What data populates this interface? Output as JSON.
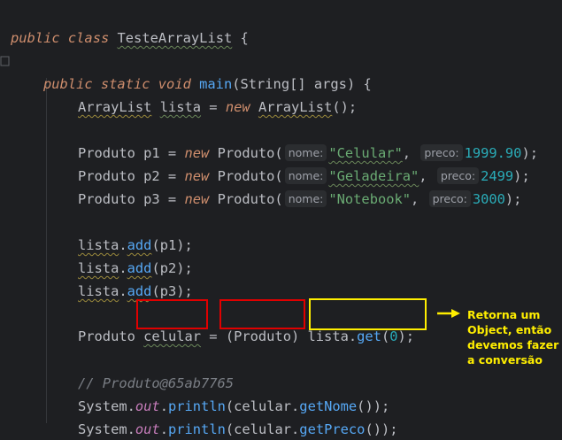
{
  "editor": {
    "lines": {
      "l1": {
        "kw1": "public",
        "kw2": "class",
        "name": "TesteArrayList",
        "brace": "{"
      },
      "l2": {
        "kw1": "public",
        "kw2": "static",
        "kw3": "void",
        "method": "main",
        "rest": "(String[] args) {"
      },
      "l3": {
        "type": "ArrayList",
        "var": "lista",
        "eq": " = ",
        "kw": "new",
        "ctor": "ArrayList",
        "rest": "();"
      },
      "l5": {
        "decl": "Produto p1 = ",
        "kw": "new",
        "ctor": "Produto(",
        "hint1": "nome:",
        "str": "\"Celular\"",
        "comma": ",",
        "hint2": "preco:",
        "num": "1999.90",
        "end": ");"
      },
      "l6": {
        "decl": "Produto p2 = ",
        "kw": "new",
        "ctor": "Produto(",
        "hint1": "nome:",
        "str": "\"Geladeira\"",
        "comma": ",",
        "hint2": "preco:",
        "num": "2499",
        "end": ");"
      },
      "l7": {
        "decl": "Produto p3 = ",
        "kw": "new",
        "ctor": "Produto(",
        "hint1": "nome:",
        "str": "\"Notebook\"",
        "comma": ",",
        "hint2": "preco:",
        "num": "3000",
        "end": ");"
      },
      "l9": {
        "obj": "lista",
        "dot": ".",
        "method": "add",
        "rest": "(p1);"
      },
      "l10": {
        "obj": "lista",
        "dot": ".",
        "method": "add",
        "rest": "(p2);"
      },
      "l11": {
        "obj": "lista",
        "dot": ".",
        "method": "add",
        "rest": "(p3);"
      },
      "l13": {
        "type": "Produto ",
        "var": "celular",
        "eq": " = ",
        "cast": "(Produto)",
        "obj": "lista",
        "dot": ".",
        "method": "get",
        "open": "(",
        "num": "0",
        "end": ");"
      },
      "l15": {
        "comment": "// Produto@65ab7765"
      },
      "l16": {
        "cls": "System",
        "dot1": ".",
        "field": "out",
        "dot2": ".",
        "method": "println",
        "open": "(",
        "obj": "celular",
        "dot3": ".",
        "method2": "getNome",
        "end": "());"
      },
      "l17": {
        "cls": "System",
        "dot1": ".",
        "field": "out",
        "dot2": ".",
        "method": "println",
        "open": "(",
        "obj": "celular",
        "dot3": ".",
        "method2": "getPreco",
        "end": "());"
      }
    }
  },
  "annotation": {
    "line1": "Retorna um",
    "line2": "Object, então",
    "line3": "devemos fazer",
    "line4": "a conversão"
  },
  "colors": {
    "background": "#1e1f22",
    "keyword": "#cf8e6d",
    "string": "#6aab73",
    "number": "#2aacb8",
    "method": "#56a8f5",
    "highlight_red": "#e00000",
    "highlight_yellow": "#ffee00"
  }
}
